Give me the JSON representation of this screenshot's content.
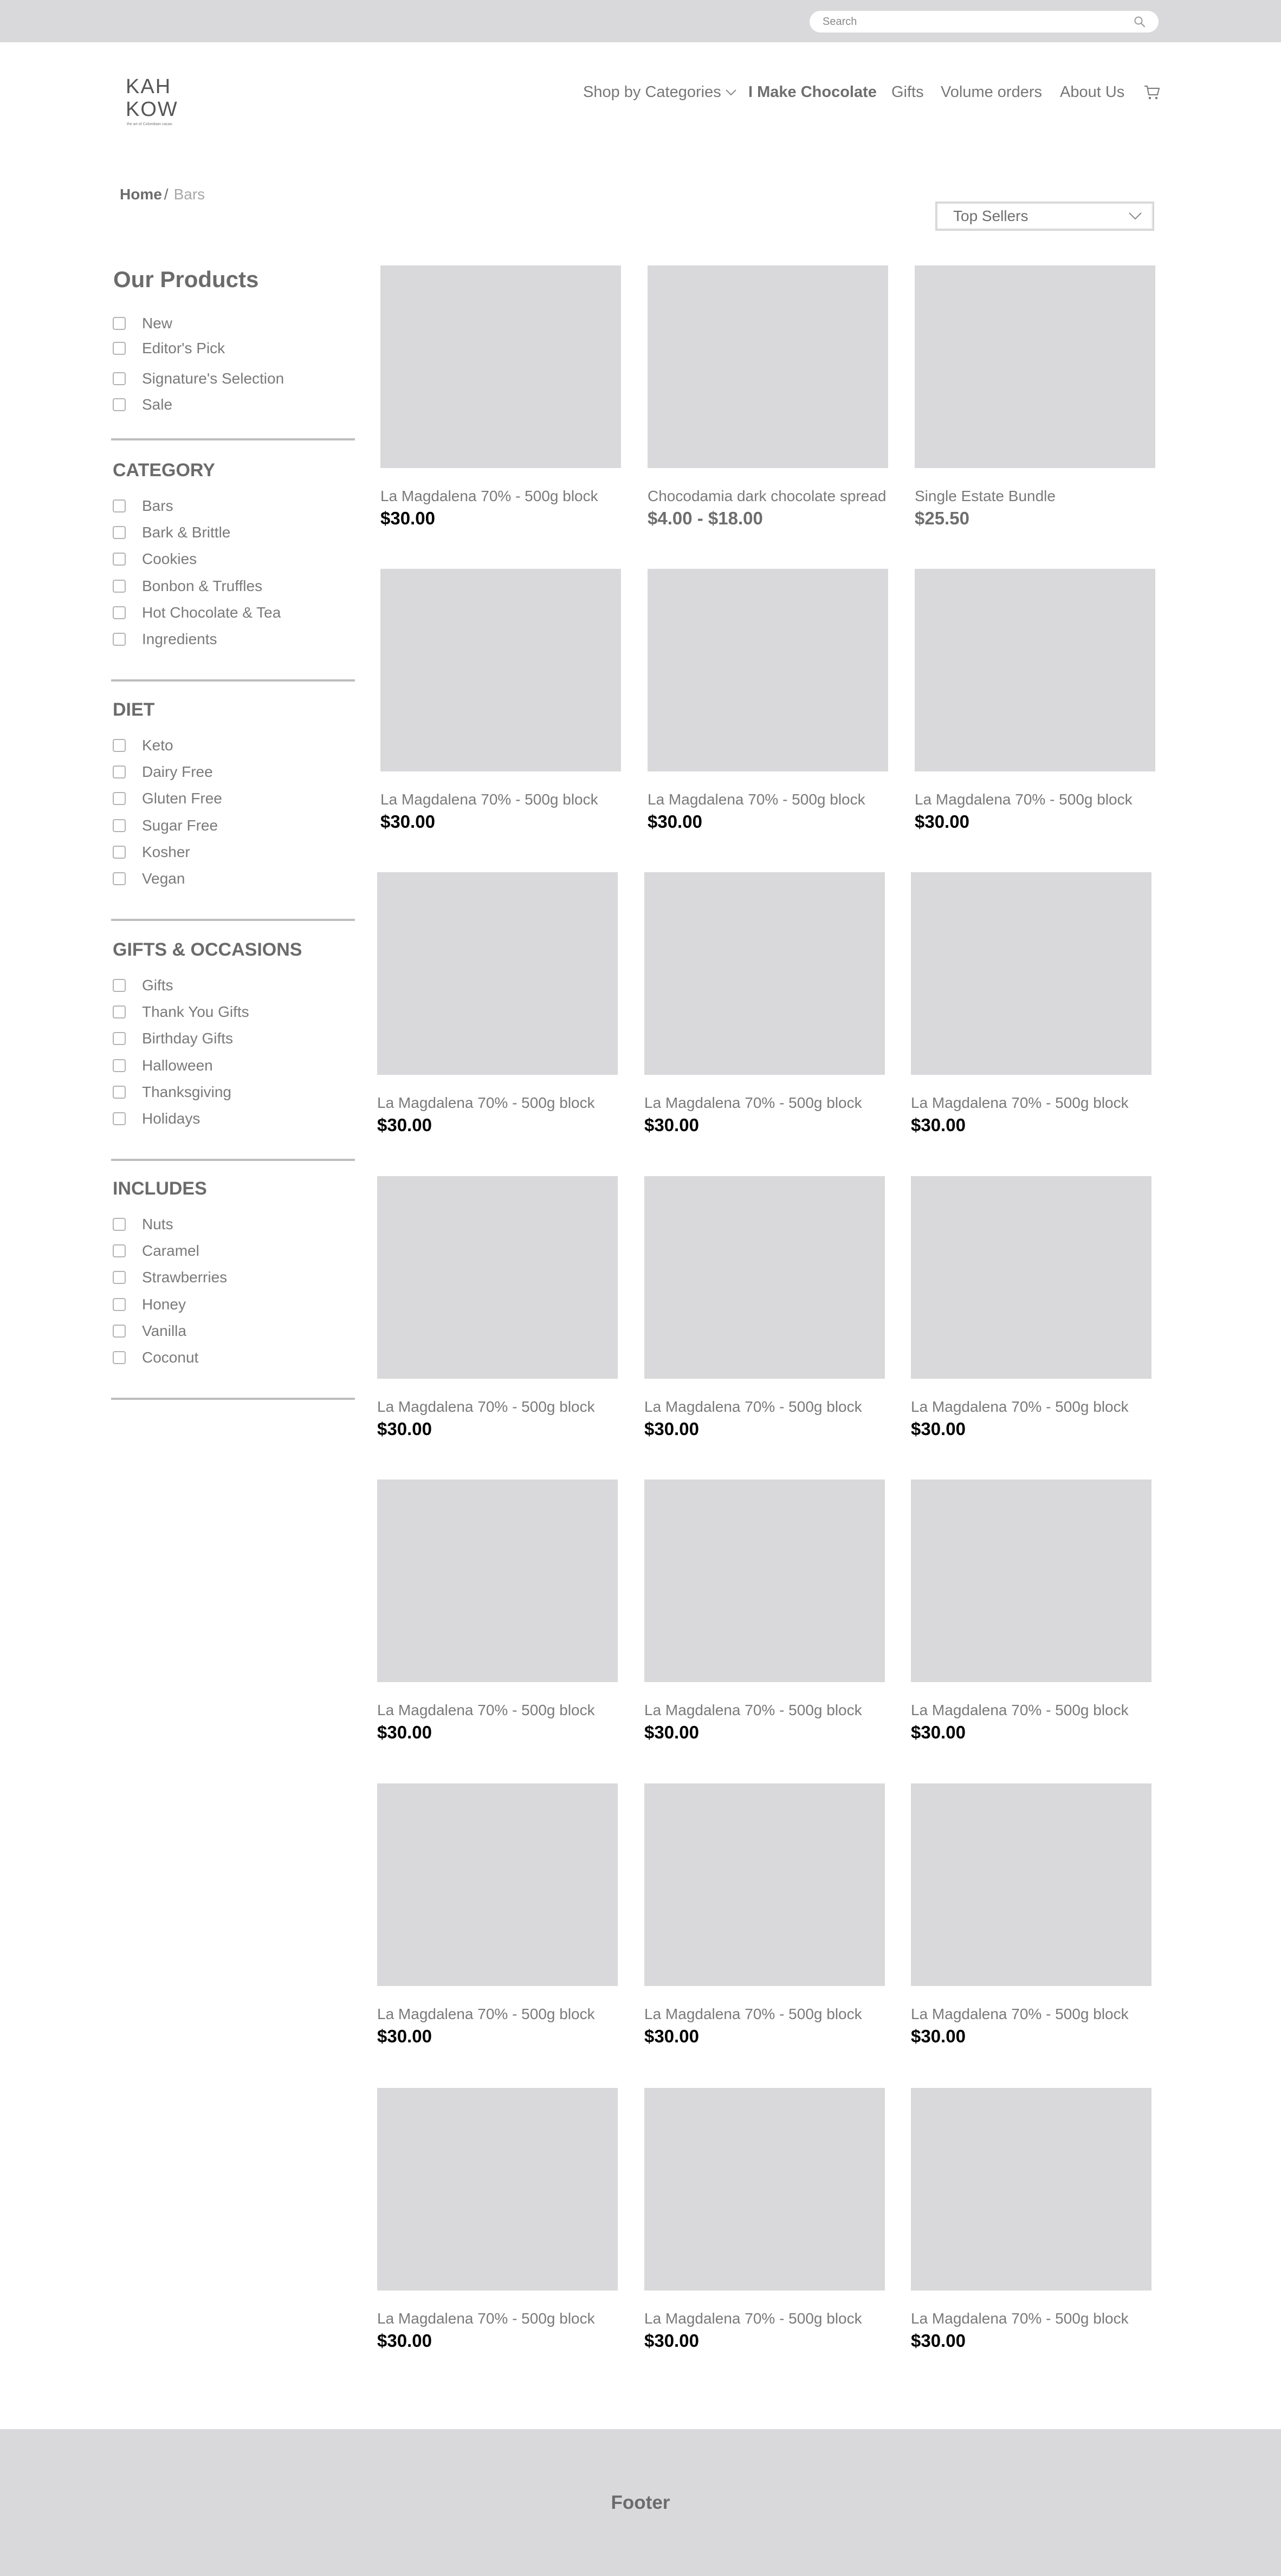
{
  "topbar": {
    "search": {
      "placeholder": "Search",
      "icon": "search-icon"
    }
  },
  "header": {
    "logo": {
      "line1": "KAH",
      "line2": "KOW",
      "tagline": "the art of Colombian cacao"
    },
    "nav": [
      {
        "label": "Shop by Categories",
        "has_dropdown": true,
        "bold": false
      },
      {
        "label": "I Make Chocolate",
        "has_dropdown": false,
        "bold": true
      },
      {
        "label": "Gifts",
        "has_dropdown": false,
        "bold": false
      },
      {
        "label": "Volume orders",
        "has_dropdown": false,
        "bold": false
      },
      {
        "label": "About Us",
        "has_dropdown": false,
        "bold": false
      }
    ],
    "cart_icon": "cart-icon"
  },
  "breadcrumb": {
    "home": "Home",
    "separator": "/",
    "current": "Bars"
  },
  "sort": {
    "selected": "Top Sellers"
  },
  "sidebar": {
    "title": "Our Products",
    "top_filters": [
      "New",
      "Editor's Pick",
      "Signature's Selection",
      "Sale"
    ],
    "groups": [
      {
        "heading": "CATEGORY",
        "items": [
          "Bars",
          "Bark & Brittle",
          "Cookies",
          "Bonbon & Truffles",
          "Hot Chocolate & Tea",
          "Ingredients"
        ]
      },
      {
        "heading": "DIET",
        "items": [
          "Keto",
          "Dairy Free",
          "Gluten Free",
          "Sugar Free",
          "Kosher",
          "Vegan"
        ]
      },
      {
        "heading": "GIFTS & OCCASIONS",
        "items": [
          "Gifts",
          "Thank You Gifts",
          "Birthday Gifts",
          "Halloween",
          "Thanksgiving",
          "Holidays"
        ]
      },
      {
        "heading": "INCLUDES",
        "items": [
          "Nuts",
          "Caramel",
          "Strawberries",
          "Honey",
          "Vanilla",
          "Coconut"
        ]
      }
    ]
  },
  "products": [
    {
      "name": "La Magdalena 70% - 500g block",
      "price": "$30.00",
      "muted": false
    },
    {
      "name": "Chocodamia dark chocolate spread",
      "price": "$4.00 - $18.00",
      "muted": true
    },
    {
      "name": "Single Estate Bundle",
      "price": "$25.50",
      "muted": true
    },
    {
      "name": "La Magdalena 70% - 500g block",
      "price": "$30.00",
      "muted": false
    },
    {
      "name": "La Magdalena 70% - 500g block",
      "price": "$30.00",
      "muted": false
    },
    {
      "name": "La Magdalena 70% - 500g block",
      "price": "$30.00",
      "muted": false
    },
    {
      "name": "La Magdalena 70% - 500g block",
      "price": "$30.00",
      "muted": false
    },
    {
      "name": "La Magdalena 70% - 500g block",
      "price": "$30.00",
      "muted": false
    },
    {
      "name": "La Magdalena 70% - 500g block",
      "price": "$30.00",
      "muted": false
    },
    {
      "name": "La Magdalena 70% - 500g block",
      "price": "$30.00",
      "muted": false
    },
    {
      "name": "La Magdalena 70% - 500g block",
      "price": "$30.00",
      "muted": false
    },
    {
      "name": "La Magdalena 70% - 500g block",
      "price": "$30.00",
      "muted": false
    },
    {
      "name": "La Magdalena 70% - 500g block",
      "price": "$30.00",
      "muted": false
    },
    {
      "name": "La Magdalena 70% - 500g block",
      "price": "$30.00",
      "muted": false
    },
    {
      "name": "La Magdalena 70% - 500g block",
      "price": "$30.00",
      "muted": false
    },
    {
      "name": "La Magdalena 70% - 500g block",
      "price": "$30.00",
      "muted": false
    },
    {
      "name": "La Magdalena 70% - 500g block",
      "price": "$30.00",
      "muted": false
    },
    {
      "name": "La Magdalena 70% - 500g block",
      "price": "$30.00",
      "muted": false
    },
    {
      "name": "La Magdalena 70% - 500g block",
      "price": "$30.00",
      "muted": false
    },
    {
      "name": "La Magdalena 70% - 500g block",
      "price": "$30.00",
      "muted": false
    },
    {
      "name": "La Magdalena 70% - 500g block",
      "price": "$30.00",
      "muted": false
    }
  ],
  "footer": {
    "label": "Footer"
  },
  "colors": {
    "placeholder_gray": "#d9d9db",
    "text_gray": "#6b6b6b",
    "price_black": "#000000",
    "divider_gray": "#bdbdbd"
  }
}
